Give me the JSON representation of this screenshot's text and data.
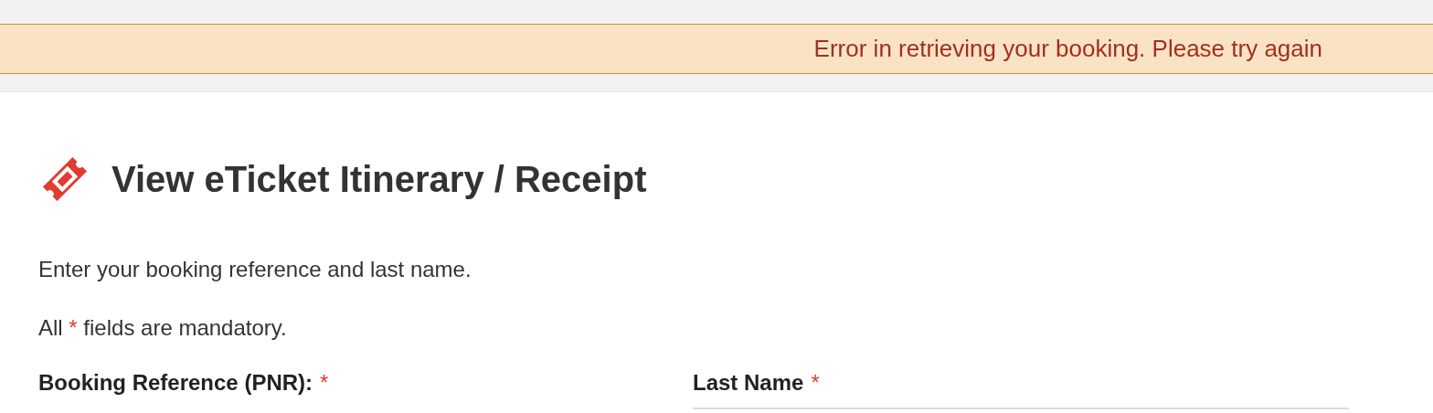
{
  "alert": {
    "message": "Error in retrieving your booking. Please try again"
  },
  "heading": {
    "title": "View eTicket Itinerary / Receipt"
  },
  "instructions": "Enter your booking reference and last name.",
  "mandatory_note": {
    "before": "All",
    "marker": "*",
    "after": "fields are mandatory."
  },
  "fields": [
    {
      "label": "Booking Reference (PNR):",
      "marker": "*",
      "underline": false
    },
    {
      "label": "Last Name",
      "marker": "*",
      "underline": true
    }
  ]
}
